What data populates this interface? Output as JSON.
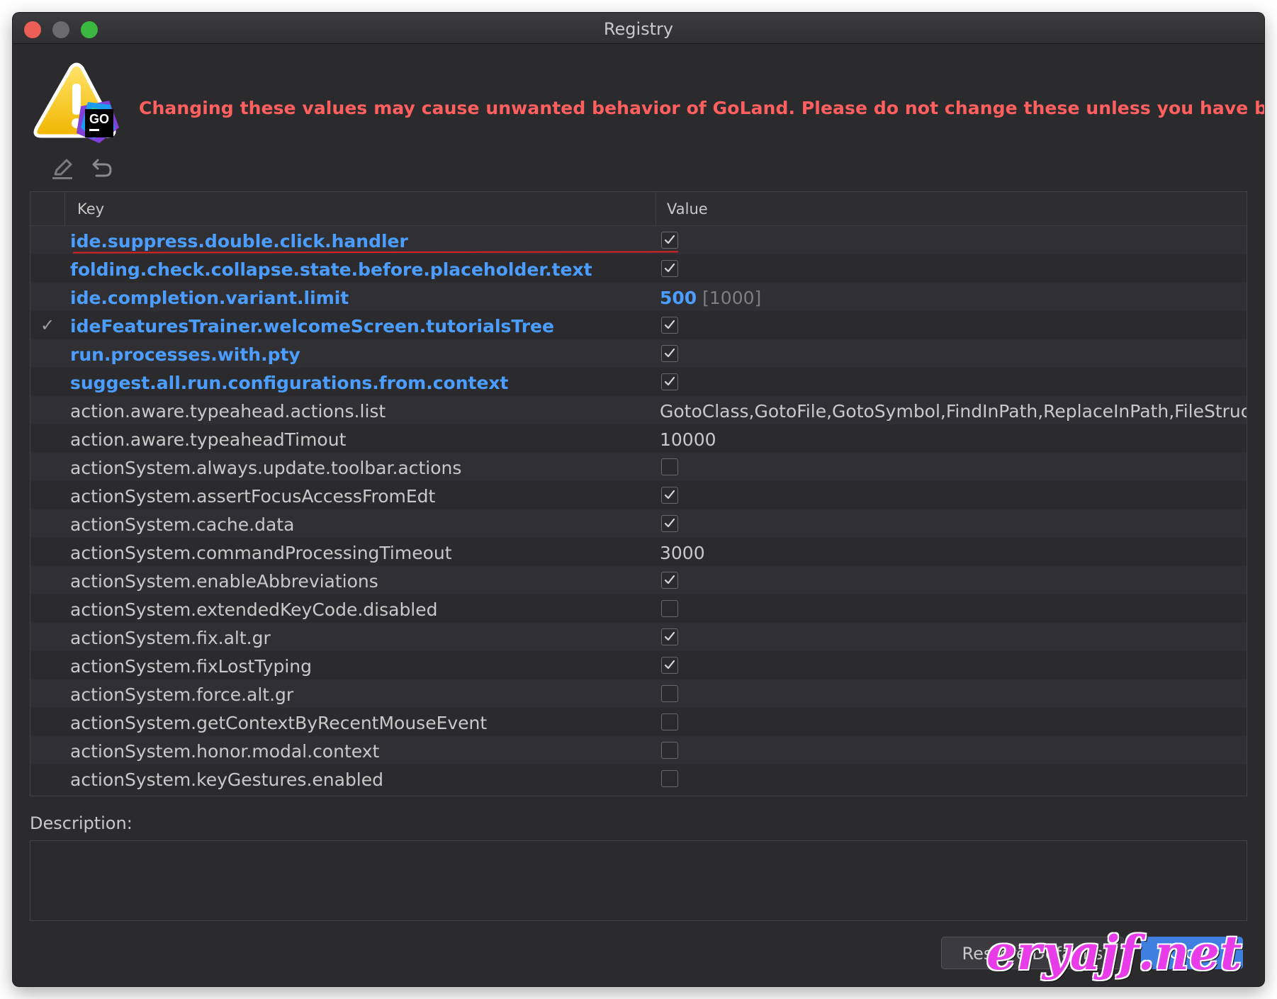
{
  "window": {
    "title": "Registry"
  },
  "warning": {
    "text": "Changing these values may cause unwanted behavior of GoLand. Please do not change these unless you have been asked.",
    "icon_badge": "GO",
    "icon": "warning-triangle-icon"
  },
  "toolbar": {
    "edit_icon": "pencil-icon",
    "revert_icon": "undo-icon"
  },
  "table": {
    "headers": {
      "key": "Key",
      "value": "Value"
    },
    "rows": [
      {
        "key": "ide.suppress.double.click.handler",
        "modified": true,
        "type": "bool",
        "checked": true,
        "marked": false,
        "underlined": true
      },
      {
        "key": "folding.check.collapse.state.before.placeholder.text",
        "modified": true,
        "type": "bool",
        "checked": true,
        "marked": false
      },
      {
        "key": "ide.completion.variant.limit",
        "modified": true,
        "type": "text",
        "value": "500",
        "default": "[1000]",
        "marked": false
      },
      {
        "key": "ideFeaturesTrainer.welcomeScreen.tutorialsTree",
        "modified": true,
        "type": "bool",
        "checked": true,
        "marked": true
      },
      {
        "key": "run.processes.with.pty",
        "modified": true,
        "type": "bool",
        "checked": true,
        "marked": false
      },
      {
        "key": "suggest.all.run.configurations.from.context",
        "modified": true,
        "type": "bool",
        "checked": true,
        "marked": false
      },
      {
        "key": "action.aware.typeahead.actions.list",
        "modified": false,
        "type": "text",
        "value": "GotoClass,GotoFile,GotoSymbol,FindInPath,ReplaceInPath,FileStruc",
        "marked": false
      },
      {
        "key": "action.aware.typeaheadTimout",
        "modified": false,
        "type": "text",
        "value": "10000",
        "marked": false
      },
      {
        "key": "actionSystem.always.update.toolbar.actions",
        "modified": false,
        "type": "bool",
        "checked": false,
        "marked": false
      },
      {
        "key": "actionSystem.assertFocusAccessFromEdt",
        "modified": false,
        "type": "bool",
        "checked": true,
        "marked": false
      },
      {
        "key": "actionSystem.cache.data",
        "modified": false,
        "type": "bool",
        "checked": true,
        "marked": false
      },
      {
        "key": "actionSystem.commandProcessingTimeout",
        "modified": false,
        "type": "text",
        "value": "3000",
        "marked": false
      },
      {
        "key": "actionSystem.enableAbbreviations",
        "modified": false,
        "type": "bool",
        "checked": true,
        "marked": false
      },
      {
        "key": "actionSystem.extendedKeyCode.disabled",
        "modified": false,
        "type": "bool",
        "checked": false,
        "marked": false
      },
      {
        "key": "actionSystem.fix.alt.gr",
        "modified": false,
        "type": "bool",
        "checked": true,
        "marked": false
      },
      {
        "key": "actionSystem.fixLostTyping",
        "modified": false,
        "type": "bool",
        "checked": true,
        "marked": false
      },
      {
        "key": "actionSystem.force.alt.gr",
        "modified": false,
        "type": "bool",
        "checked": false,
        "marked": false
      },
      {
        "key": "actionSystem.getContextByRecentMouseEvent",
        "modified": false,
        "type": "bool",
        "checked": false,
        "marked": false
      },
      {
        "key": "actionSystem.honor.modal.context",
        "modified": false,
        "type": "bool",
        "checked": false,
        "marked": false
      },
      {
        "key": "actionSystem.keyGestures.enabled",
        "modified": false,
        "type": "bool",
        "checked": false,
        "marked": false
      }
    ],
    "mark_glyph": "✓"
  },
  "description": {
    "label": "Description:",
    "value": ""
  },
  "buttons": {
    "restore_label": "Restore Defaults",
    "close_label": "Close"
  },
  "watermark": {
    "text": "eryajf.net"
  },
  "colors": {
    "background": "#2b2b2e",
    "modified_key": "#4b9eff",
    "warning": "#ff5f5f",
    "primary_button": "#3f7fe0",
    "watermark": "#e83ce8"
  }
}
